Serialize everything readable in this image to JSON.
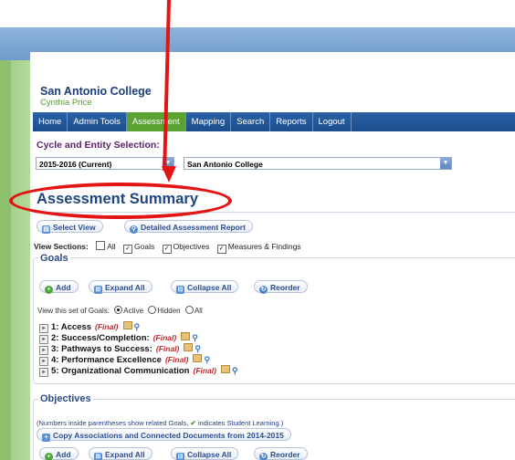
{
  "header": {
    "college_name": "San Antonio College",
    "user_name": "Cynthia Price"
  },
  "nav": {
    "items": [
      {
        "label": "Home"
      },
      {
        "label": "Admin Tools"
      },
      {
        "label": "Assessment",
        "active": true
      },
      {
        "label": "Mapping"
      },
      {
        "label": "Search"
      },
      {
        "label": "Reports"
      },
      {
        "label": "Logout"
      }
    ]
  },
  "cycle": {
    "label": "Cycle and Entity Selection:",
    "cycle_value": "2015-2016  (Current)",
    "entity_value": "San Antonio College"
  },
  "summary": {
    "title": "Assessment Summary",
    "select_view": "Select View",
    "detailed_report": "Detailed Assessment Report"
  },
  "view_sections": {
    "label": "View Sections:",
    "options": [
      {
        "label": "All",
        "checked": false
      },
      {
        "label": "Goals",
        "checked": true
      },
      {
        "label": "Objectives",
        "checked": true
      },
      {
        "label": "Measures & Findings",
        "checked": true
      }
    ]
  },
  "goals": {
    "title": "Goals",
    "buttons": {
      "add": "Add",
      "expand": "Expand All",
      "collapse": "Collapse All",
      "reorder": "Reorder"
    },
    "view_label": "View this set of Goals:",
    "view_options": [
      "Active",
      "Hidden",
      "All"
    ],
    "selected_view": "Active",
    "items": [
      {
        "label": "1: Access",
        "status": "(Final)"
      },
      {
        "label": "2: Success/Completion:",
        "status": "(Final)"
      },
      {
        "label": "3: Pathways to Success:",
        "status": "(Final)"
      },
      {
        "label": "4: Performance Excellence",
        "status": "(Final)"
      },
      {
        "label": "5: Organizational Communication",
        "status": "(Final)"
      }
    ]
  },
  "objectives": {
    "title": "Objectives",
    "note_prefix": "(Numbers inside parentheses show related Goals,",
    "note_suffix": " indicates Student Learning.)",
    "copy_button": "Copy Associations and Connected Documents from 2014-2015",
    "buttons": {
      "add": "Add",
      "expand": "Expand All",
      "collapse": "Collapse All",
      "reorder": "Reorder"
    }
  },
  "colors": {
    "annotation_red": "#e21414",
    "nav_blue": "#1b4d8d",
    "nav_active_green": "#5aa332",
    "title_blue": "#1f4682"
  }
}
